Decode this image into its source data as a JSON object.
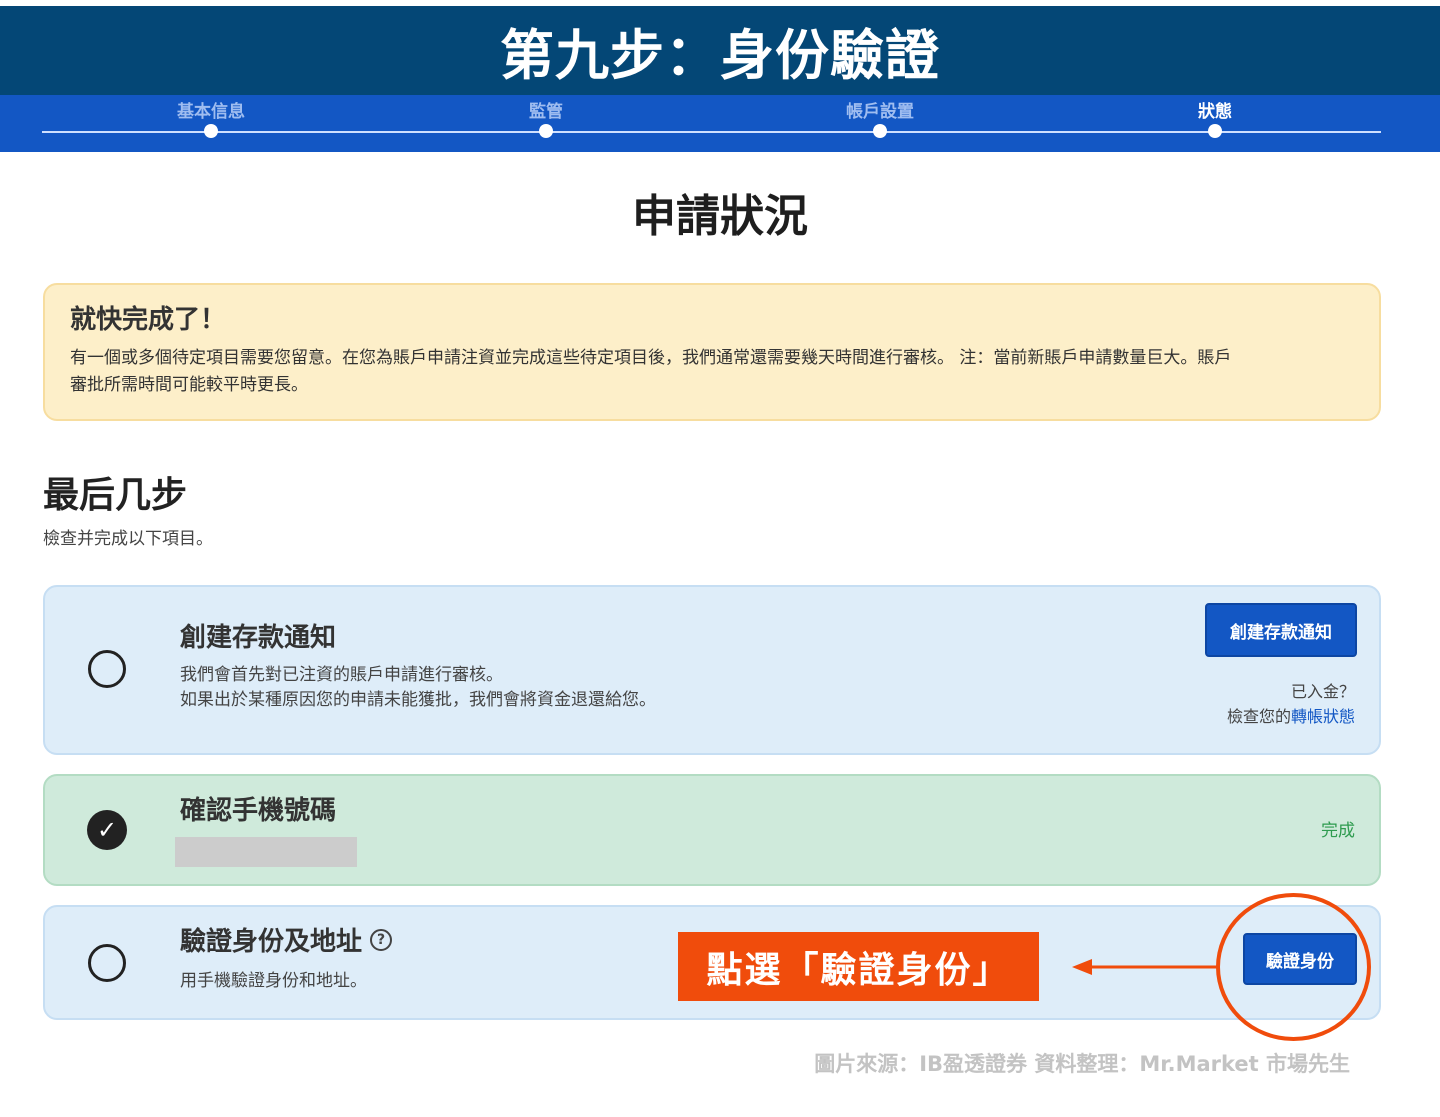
{
  "banner": {
    "title": "第九步：身份驗證"
  },
  "steps": [
    {
      "label": "基本信息",
      "active": false
    },
    {
      "label": "監管",
      "active": false
    },
    {
      "label": "帳戶設置",
      "active": false
    },
    {
      "label": "狀態",
      "active": true
    }
  ],
  "page": {
    "title": "申請狀況"
  },
  "notice": {
    "title": "就快完成了！",
    "line1": "有一個或多個待定項目需要您留意。在您為賬戶申請注資並完成這些待定項目後，我們通常還需要幾天時間進行審核。 注：當前新賬戶申請數量巨大。賬戶",
    "line2": "審批所需時間可能較平時更長。"
  },
  "section": {
    "title": "最后几步",
    "subtitle": "檢查并完成以下項目。"
  },
  "tasks": {
    "deposit": {
      "title": "創建存款通知",
      "desc1": "我們會首先對已注資的賬戶申請進行審核。",
      "desc2": "如果出於某種原因您的申請未能獲批，我們會將資金退還給您。",
      "button": "創建存款通知",
      "funded_question": "已入金？",
      "check_prefix": "檢查您的",
      "check_link": "轉帳狀態"
    },
    "phone": {
      "title": "確認手機號碼",
      "status": "完成"
    },
    "identity": {
      "title": "驗證身份及地址",
      "help_icon": "?",
      "desc": "用手機驗證身份和地址。",
      "button": "驗證身份"
    }
  },
  "annotation": {
    "callout": "點選「驗證身份」",
    "accent_color": "#f04c0c"
  },
  "footer": {
    "source": "圖片來源：IB盈透證券  資料整理：Mr.Market 市場先生"
  }
}
